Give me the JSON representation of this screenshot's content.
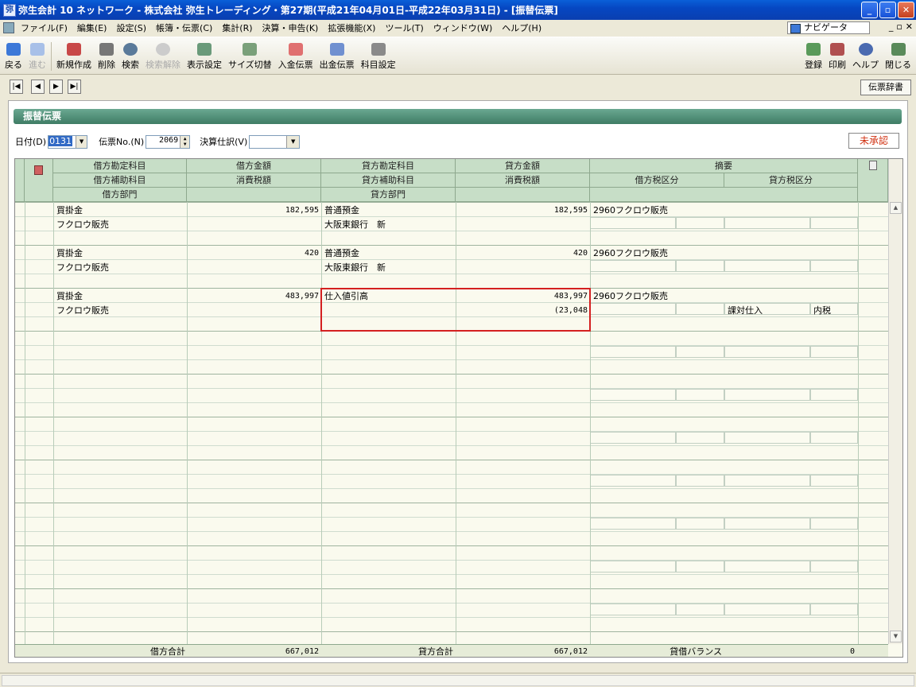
{
  "window": {
    "title": "弥生会計 10 ネットワーク - 株式会社 弥生トレーディング・第27期(平成21年04月01日-平成22年03月31日) - [振替伝票]"
  },
  "menu": [
    "ファイル(F)",
    "編集(E)",
    "設定(S)",
    "帳簿・伝票(C)",
    "集計(R)",
    "決算・申告(K)",
    "拡張機能(X)",
    "ツール(T)",
    "ウィンドウ(W)",
    "ヘルプ(H)"
  ],
  "navigator": "ナビゲータ",
  "toolbar": {
    "back": "戻る",
    "forward": "進む",
    "new": "新規作成",
    "delete": "削除",
    "search": "検索",
    "search_clear": "検索解除",
    "display_settings": "表示設定",
    "size_toggle": "サイズ切替",
    "deposit_slip": "入金伝票",
    "payment_slip": "出金伝票",
    "account_settings": "科目設定",
    "register": "登録",
    "print": "印刷",
    "help": "ヘルプ",
    "close": "閉じる"
  },
  "dict_button": "伝票辞書",
  "form": {
    "title": "振替伝票",
    "date_label": "日付(D)",
    "date_value": "0131",
    "no_label": "伝票No.(N)",
    "no_value": "2069",
    "closing_label": "決算仕訳(V)",
    "closing_value": "",
    "status": "未承認"
  },
  "headers": {
    "debit_account": "借方勘定科目",
    "debit_amount": "借方金額",
    "credit_account": "貸方勘定科目",
    "credit_amount": "貸方金額",
    "summary": "摘要",
    "debit_sub": "借方補助科目",
    "debit_tax": "消費税額",
    "credit_sub": "貸方補助科目",
    "credit_tax": "消費税額",
    "debit_tax_cat": "借方税区分",
    "credit_tax_cat": "貸方税区分",
    "debit_dept": "借方部門",
    "credit_dept": "貸方部門"
  },
  "entries": [
    {
      "debit_account": "買掛金",
      "debit_amount": "182,595",
      "credit_account": "普通預金",
      "credit_amount": "182,595",
      "summary": "2960フクロウ販売",
      "debit_sub": "フクロウ販売",
      "debit_tax": "",
      "credit_sub": "大阪東銀行　新",
      "credit_tax": "",
      "debit_tax_cat": "",
      "credit_tax_cat": "",
      "credit_tax_type": ""
    },
    {
      "debit_account": "買掛金",
      "debit_amount": "420",
      "credit_account": "普通預金",
      "credit_amount": "420",
      "summary": "2960フクロウ販売",
      "debit_sub": "フクロウ販売",
      "debit_tax": "",
      "credit_sub": "大阪東銀行　新",
      "credit_tax": "",
      "debit_tax_cat": "",
      "credit_tax_cat": "",
      "credit_tax_type": ""
    },
    {
      "debit_account": "買掛金",
      "debit_amount": "483,997",
      "credit_account": "仕入値引高",
      "credit_amount": "483,997",
      "summary": "2960フクロウ販売",
      "debit_sub": "フクロウ販売",
      "debit_tax": "",
      "credit_sub": "",
      "credit_tax": "(23,048",
      "debit_tax_cat": "",
      "credit_tax_cat": "課対仕入",
      "credit_tax_type": "内税"
    }
  ],
  "totals": {
    "debit_label": "借方合計",
    "debit_value": "667,012",
    "credit_label": "貸方合計",
    "credit_value": "667,012",
    "balance_label": "貸借バランス",
    "balance_value": "0"
  },
  "colors": {
    "header_green": "#c7dec7",
    "section_green": "#4f8c74",
    "highlight_red": "#d42020",
    "status_red": "#d03010"
  }
}
